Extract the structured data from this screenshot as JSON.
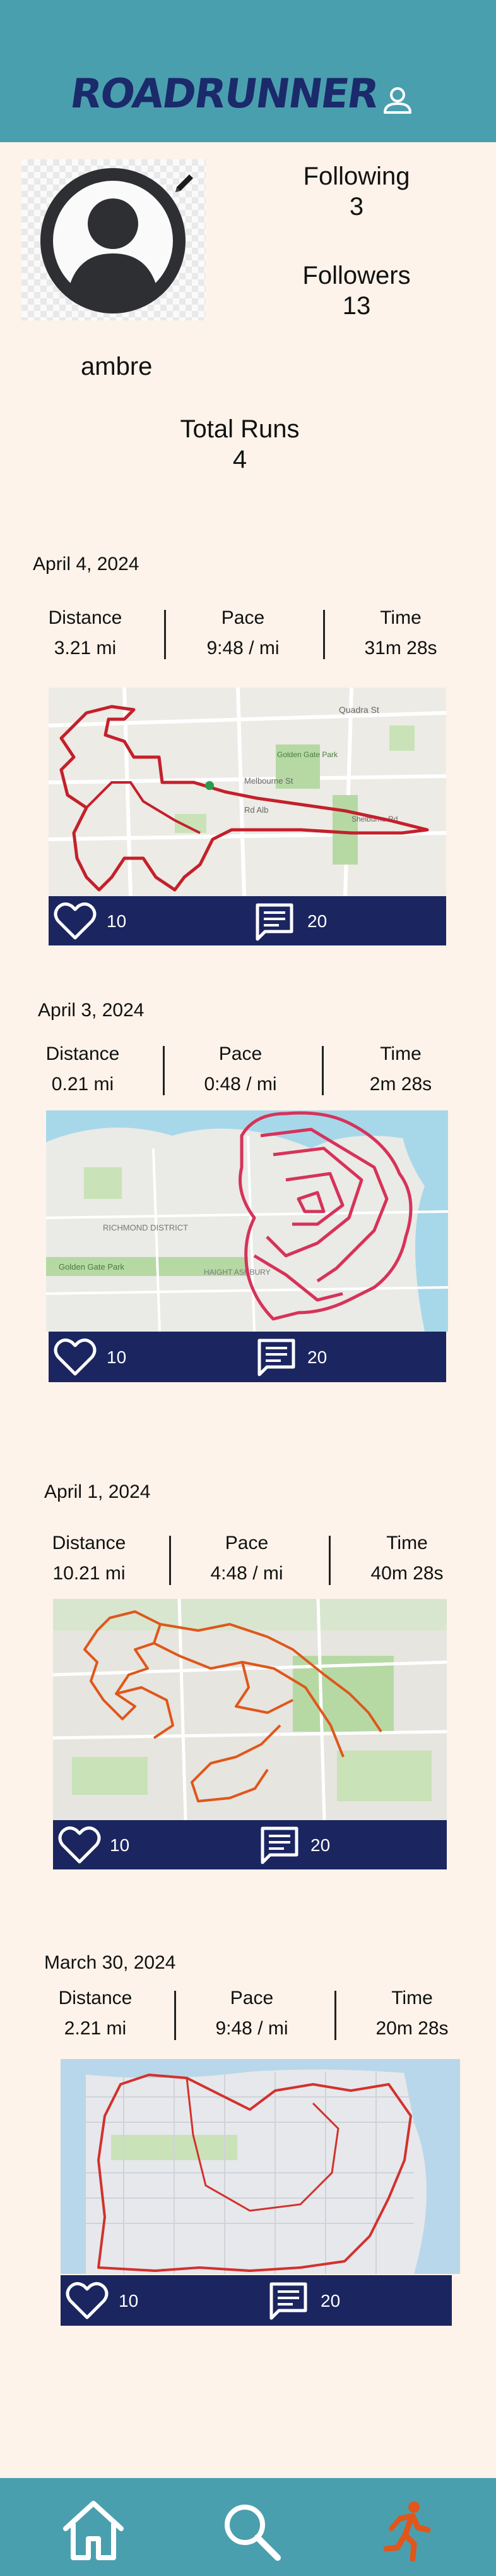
{
  "header": {
    "app_title": "ROADRUNNER",
    "profile_icon": "person-icon"
  },
  "profile": {
    "username": "ambre",
    "following_label": "Following",
    "following_count": "3",
    "followers_label": "Followers",
    "followers_count": "13",
    "total_runs_label": "Total Runs",
    "total_runs_count": "4",
    "edit_icon": "pencil-icon"
  },
  "metric_labels": {
    "distance": "Distance",
    "pace": "Pace",
    "time": "Time"
  },
  "runs": [
    {
      "date": "April 4, 2024",
      "distance": "3.21 mi",
      "pace": "9:48 / mi",
      "time": "31m 28s",
      "likes": "10",
      "comments": "20"
    },
    {
      "date": "April 3, 2024",
      "distance": "0.21 mi",
      "pace": "0:48 / mi",
      "time": "2m 28s",
      "likes": "10",
      "comments": "20"
    },
    {
      "date": "April 1, 2024",
      "distance": "10.21 mi",
      "pace": "4:48 / mi",
      "time": "40m 28s",
      "likes": "10",
      "comments": "20"
    },
    {
      "date": "March 30, 2024",
      "distance": "2.21 mi",
      "pace": "9:48 / mi",
      "time": "20m 28s",
      "likes": "10",
      "comments": "20"
    }
  ],
  "map_labels": {
    "run1": [
      "Quadra St",
      "Golden Gate Park",
      "Melbourne St",
      "Rd Alb",
      "Shelburne Rd"
    ],
    "run2": [
      "RICHMOND DISTRICT",
      "Golden Gate Park",
      "HAIGHT ASHBURY"
    ],
    "run3": [],
    "run4": []
  },
  "bottom_nav": {
    "home_icon": "home-icon",
    "search_icon": "search-icon",
    "run_icon": "runner-icon"
  },
  "colors": {
    "header": "#4a9fae",
    "logo": "#1b2a6b",
    "action_bar": "#1b2560",
    "background": "#fdf3ea",
    "route_red": "#c4202b",
    "route_orange": "#e0561b",
    "runner_active": "#e0561b"
  }
}
